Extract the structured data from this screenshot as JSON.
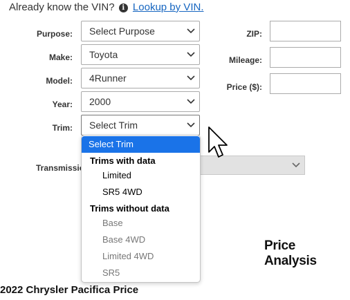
{
  "vin": {
    "prompt": "Already know the VIN?",
    "link": "Lookup by VIN."
  },
  "form": {
    "purpose": {
      "label": "Purpose:",
      "value": "Select Purpose"
    },
    "make": {
      "label": "Make:",
      "value": "Toyota"
    },
    "model": {
      "label": "Model:",
      "value": "4Runner"
    },
    "year": {
      "label": "Year:",
      "value": "2000"
    },
    "trim": {
      "label": "Trim:",
      "value": "Select Trim"
    },
    "transmission": {
      "label": "Transmissio"
    },
    "zip": {
      "label": "ZIP:",
      "value": ""
    },
    "mileage": {
      "label": "Mileage:",
      "value": ""
    },
    "price": {
      "label": "Price ($):",
      "value": ""
    }
  },
  "dropdown": {
    "selected": "Select Trim",
    "group_with": "Trims with data",
    "with_items": [
      "Limited",
      "SR5 4WD"
    ],
    "group_without": "Trims without data",
    "without_items": [
      "Base",
      "Base 4WD",
      "Limited 4WD",
      "SR5"
    ]
  },
  "headings": {
    "price_analysis": "Price Analysis",
    "pacifica": "2022 Chrysler Pacifica Price"
  },
  "icons": {
    "info": "info-icon",
    "chevron": "chevron-down-icon",
    "cursor": "mouse-pointer-icon"
  },
  "colors": {
    "link": "#1565c0",
    "highlight": "#1a73e8"
  }
}
